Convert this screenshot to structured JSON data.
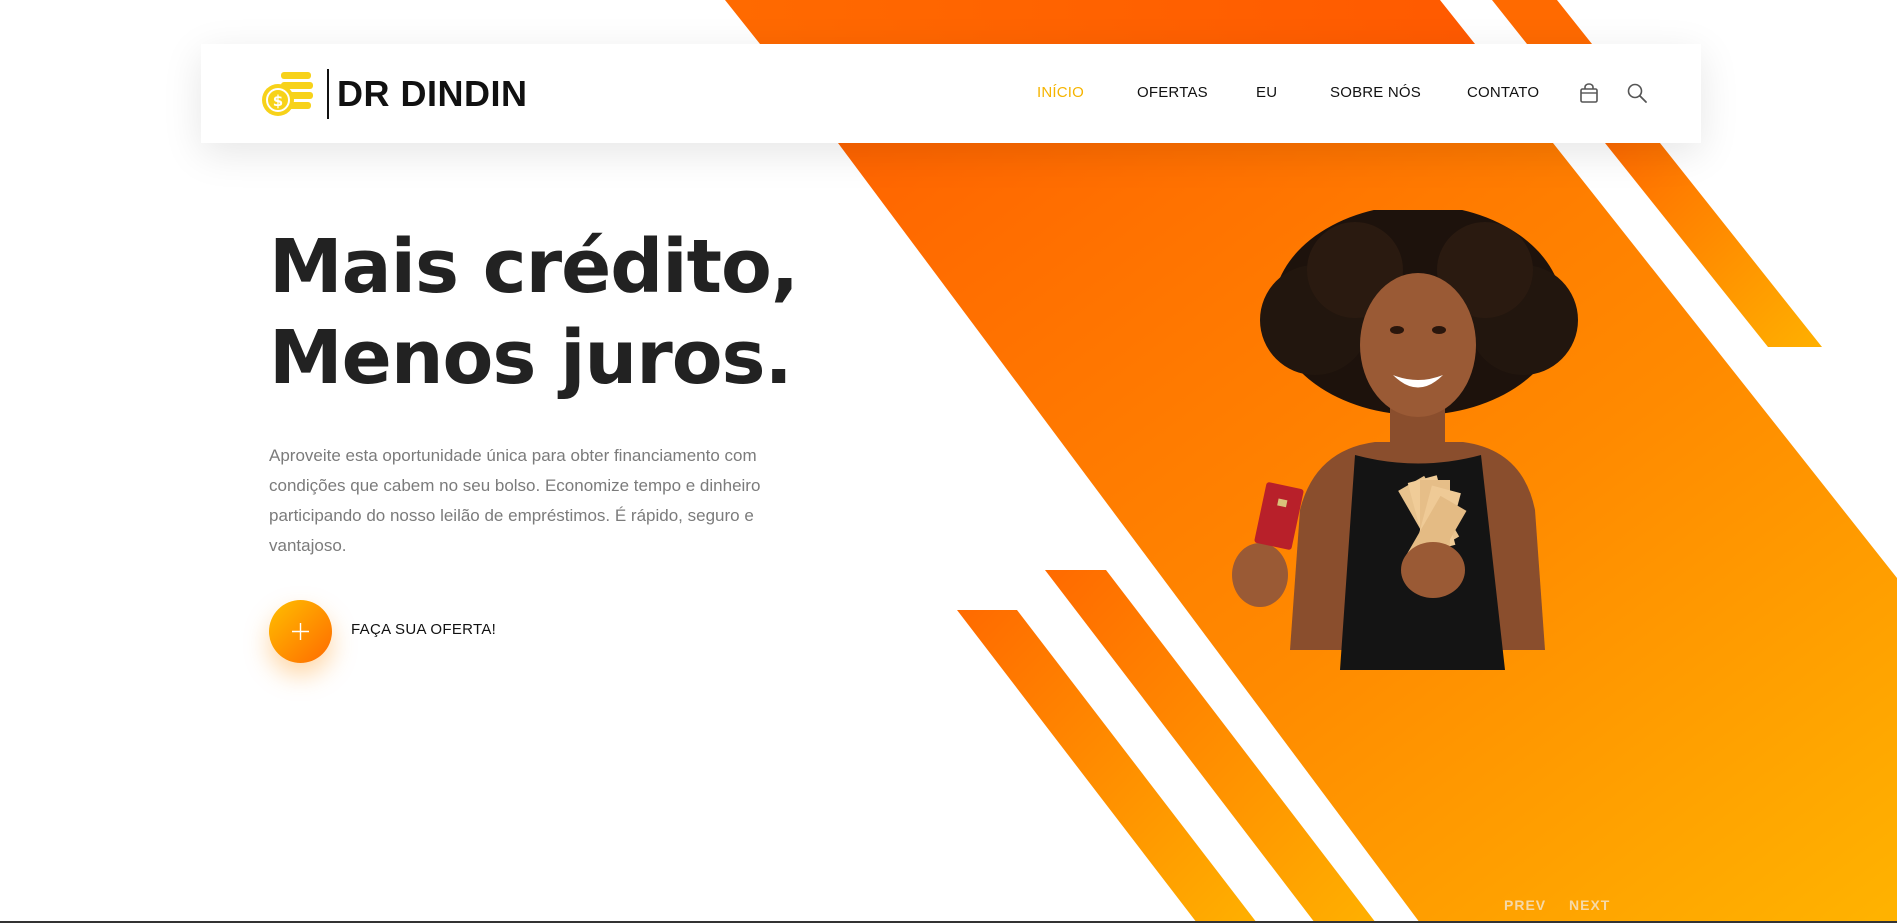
{
  "brand": {
    "name": "DR DINDIN",
    "logo_icon": "coin-stack-icon",
    "colors": {
      "accent": "#f5b400",
      "orange": "#ff6a00",
      "yellow": "#ffbf00",
      "text": "#222222"
    }
  },
  "nav": {
    "items": [
      {
        "label": "INÍCIO",
        "active": true
      },
      {
        "label": "OFERTAS",
        "active": false
      },
      {
        "label": "EU",
        "active": false
      },
      {
        "label": "SOBRE NÓS",
        "active": false
      },
      {
        "label": "CONTATO",
        "active": false
      }
    ],
    "icons": [
      "shopping-bag-icon",
      "search-icon"
    ]
  },
  "hero": {
    "title_line1": "Mais crédito,",
    "title_line2": "Menos juros.",
    "text": "Aproveite esta oportunidade única para obter financiamento com condições que cabem no seu bolso. Economize tempo e dinheiro participando do nosso leilão de empréstimos. É rápido, seguro e vantajoso.",
    "cta_label": "FAÇA SUA OFERTA!",
    "cta_icon": "plus-icon",
    "image": "woman-holding-money-and-card-photo"
  },
  "slider": {
    "prev": "PREV",
    "next": "NEXT"
  }
}
